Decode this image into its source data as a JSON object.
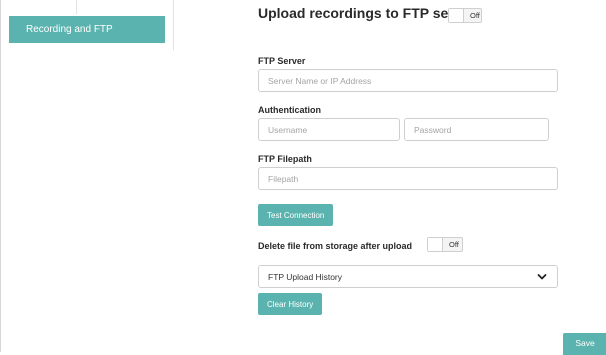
{
  "sidebar": {
    "items": [
      {
        "label": "Recording and FTP",
        "active": true
      }
    ]
  },
  "main": {
    "title": "Upload recordings to FTP server",
    "upload_toggle": {
      "state": "Off"
    },
    "ftp_server": {
      "label": "FTP Server",
      "placeholder": "Server Name or IP Address",
      "value": ""
    },
    "authentication": {
      "label": "Authentication",
      "username_placeholder": "Username",
      "password_placeholder": "Password"
    },
    "ftp_filepath": {
      "label": "FTP Filepath",
      "placeholder": "Filepath",
      "value": ""
    },
    "test_connection_label": "Test Connection",
    "delete_after_upload": {
      "label": "Delete file from storage after upload",
      "state": "Off"
    },
    "history_select": {
      "selected": "FTP Upload History",
      "icon": "chevron-down-icon"
    },
    "clear_history_label": "Clear History"
  },
  "footer": {
    "save_label": "Save"
  },
  "colors": {
    "accent": "#5ab3ae",
    "border": "#cfcfcf",
    "text": "#2a2a2a",
    "placeholder": "#a4a4a4"
  }
}
